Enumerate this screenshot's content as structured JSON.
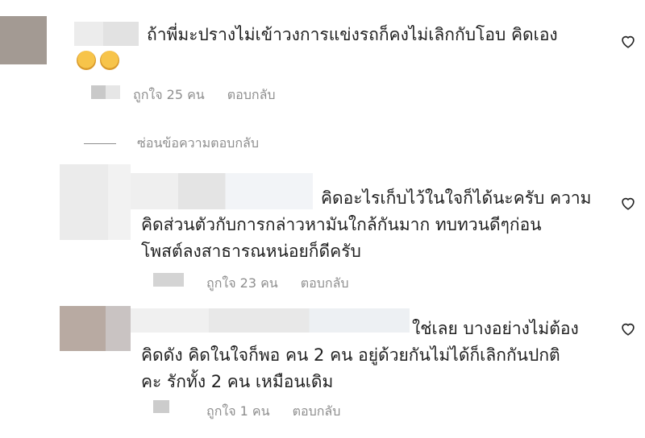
{
  "comments": [
    {
      "text": "ถ้าพี่มะปรางไม่เข้าวงการแข่งรถก็คงไม่เลิกกับโอบ คิดเอง",
      "emojis": [
        "crying-face",
        "tears-of-joy-face"
      ],
      "likes": "ถูกใจ 25 คน",
      "reply": "ตอบกลับ"
    },
    {
      "text": "คิดอะไรเก็บไว้ในใจก็ได้นะครับ ความ\nคิดส่วนตัวกับการกล่าวหามันใกล้กันมาก ทบทวนดีๆก่อน\nโพสต์ลงสาธารณหน่อยก็ดีครับ",
      "likes": "ถูกใจ 23 คน",
      "reply": "ตอบกลับ"
    },
    {
      "text": "ใช่เลย บางอย่างไม่ต้อง\nคิดดัง คิดในใจก็พอ คน 2 คน อยู่ด้วยกันไม่ได้ก็เลิกกันปกติ\nคะ รักทั้ง 2 คน เหมือนเดิม",
      "likes": "ถูกใจ 1 คน",
      "reply": "ตอบกลับ"
    }
  ],
  "hide_replies_label": "ซ่อนข้อความตอบกลับ",
  "colors": {
    "meta": "#8e8e8e",
    "text": "#1f1f1f",
    "heart": "#262626"
  }
}
